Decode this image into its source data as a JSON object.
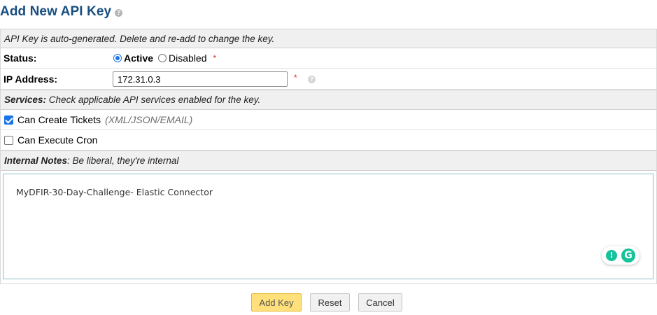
{
  "page": {
    "title": "Add New API Key",
    "help_icon": "help-circle-icon"
  },
  "form": {
    "info_header": "API Key is auto-generated. Delete and re-add to change the key.",
    "status": {
      "label": "Status:",
      "options": [
        "Active",
        "Disabled"
      ],
      "selected": "Active",
      "required_mark": "*"
    },
    "ip_address": {
      "label": "IP Address:",
      "value": "172.31.0.3",
      "required_mark": "*"
    },
    "services": {
      "header_bold": "Services:",
      "header_text": " Check applicable API services enabled for the key.",
      "items": [
        {
          "label": "Can Create Tickets",
          "note": "(XML/JSON/EMAIL)",
          "checked": true
        },
        {
          "label": "Can Execute Cron",
          "note": "",
          "checked": false
        }
      ]
    },
    "notes": {
      "header_bold": "Internal Notes",
      "header_text": ": Be liberal, they're internal",
      "value": "MyDFIR-30-Day-Challenge- Elastic Connector"
    }
  },
  "actions": {
    "add_label": "Add Key",
    "reset_label": "Reset",
    "cancel_label": "Cancel"
  },
  "colors": {
    "title": "#184e81",
    "primary_button": "#ffe07a",
    "accent": "#1a73e8",
    "grammarly": "#15c39a"
  }
}
